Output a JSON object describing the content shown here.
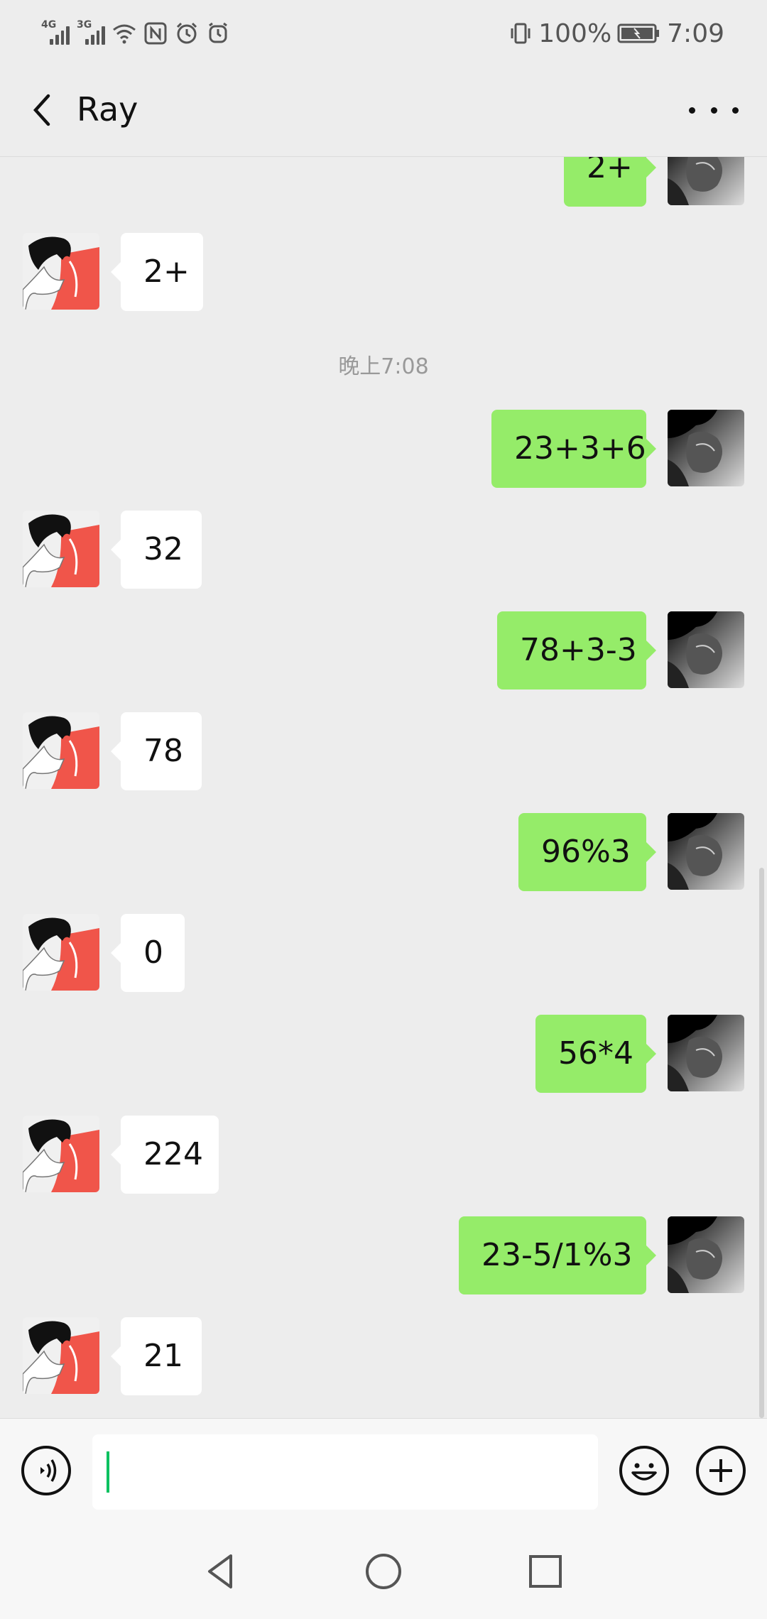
{
  "status_bar": {
    "signal_1_label": "4G",
    "signal_2_label": "3G",
    "battery_text": "100%",
    "time": "7:09",
    "icons": [
      "signal-icon",
      "wifi-icon",
      "nfc-icon",
      "alarm-icon",
      "vibrate-icon",
      "battery-icon"
    ]
  },
  "header": {
    "title": "Ray",
    "back_icon": "chevron-left-icon",
    "more_icon": "more-icon"
  },
  "chat": {
    "timestamp": "晚上7:08",
    "messages": [
      {
        "side": "out",
        "text": "2+"
      },
      {
        "side": "in",
        "text": "2+"
      },
      {
        "side": "out",
        "text": "23+3+6"
      },
      {
        "side": "in",
        "text": "32"
      },
      {
        "side": "out",
        "text": "78+3-3"
      },
      {
        "side": "in",
        "text": "78"
      },
      {
        "side": "out",
        "text": "96%3"
      },
      {
        "side": "in",
        "text": "0"
      },
      {
        "side": "out",
        "text": "56*4"
      },
      {
        "side": "in",
        "text": "224"
      },
      {
        "side": "out",
        "text": "23-5/1%3"
      },
      {
        "side": "in",
        "text": "21"
      }
    ]
  },
  "input_bar": {
    "voice_icon": "voice-icon",
    "input_value": "",
    "emoji_icon": "emoji-icon",
    "plus_icon": "plus-icon"
  },
  "system_nav": {
    "icons": [
      "back-triangle-icon",
      "home-circle-icon",
      "recents-square-icon"
    ]
  },
  "colors": {
    "background": "#ededed",
    "outgoing_bubble": "#95ec69",
    "incoming_bubble": "#ffffff",
    "caret": "#07c160"
  }
}
